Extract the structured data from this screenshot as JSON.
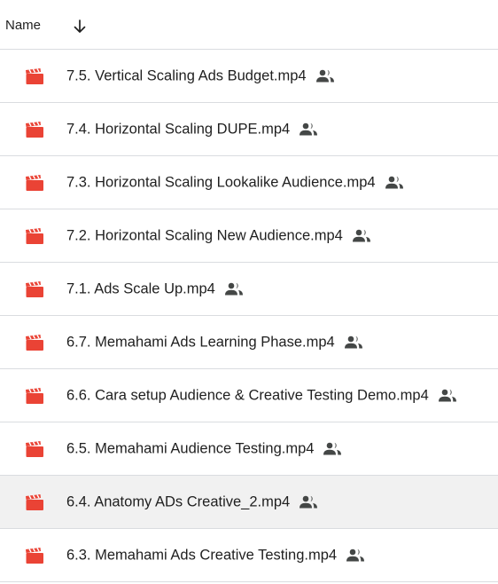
{
  "header": {
    "name_label": "Name",
    "sort_icon": "arrow-down-icon"
  },
  "colors": {
    "video_icon": "#ea4335",
    "shared_icon": "#444746",
    "divider": "#dadce0",
    "selected_row": "#f1f1f1"
  },
  "files": [
    {
      "name": "7.5. Vertical Scaling Ads Budget.mp4",
      "icon": "video-file-icon",
      "shared": true
    },
    {
      "name": "7.4. Horizontal Scaling DUPE.mp4",
      "icon": "video-file-icon",
      "shared": true
    },
    {
      "name": "7.3. Horizontal Scaling Lookalike Audience.mp4",
      "icon": "video-file-icon",
      "shared": true
    },
    {
      "name": "7.2. Horizontal Scaling New Audience.mp4",
      "icon": "video-file-icon",
      "shared": true
    },
    {
      "name": "7.1. Ads Scale Up.mp4",
      "icon": "video-file-icon",
      "shared": true
    },
    {
      "name": "6.7. Memahami Ads Learning Phase.mp4",
      "icon": "video-file-icon",
      "shared": true
    },
    {
      "name": "6.6. Cara setup Audience & Creative Testing Demo.mp4",
      "icon": "video-file-icon",
      "shared": true
    },
    {
      "name": "6.5. Memahami Audience Testing.mp4",
      "icon": "video-file-icon",
      "shared": true
    },
    {
      "name": "6.4. Anatomy ADs Creative_2.mp4",
      "icon": "video-file-icon",
      "shared": true,
      "selected": true
    },
    {
      "name": "6.3. Memahami Ads Creative Testing.mp4",
      "icon": "video-file-icon",
      "shared": true
    }
  ]
}
